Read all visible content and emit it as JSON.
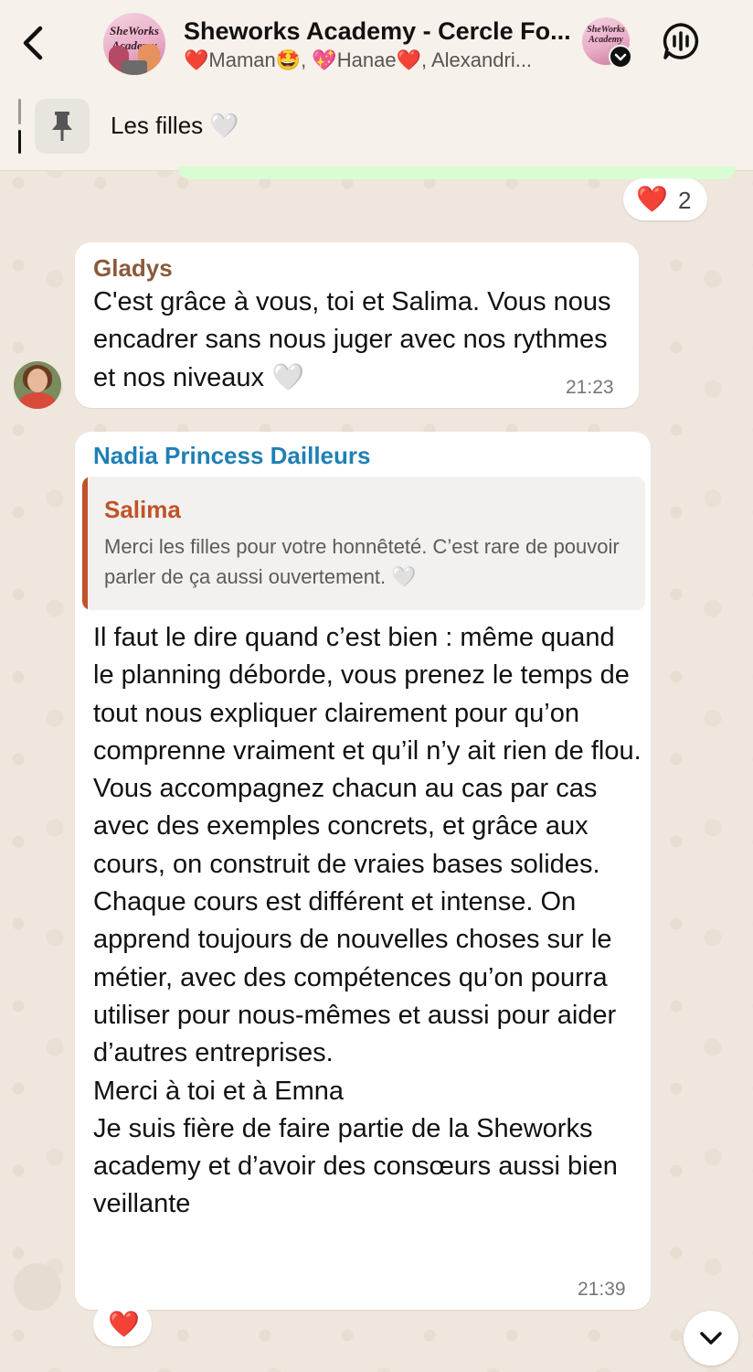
{
  "header": {
    "title": "Sheworks Academy - Cercle Fo...",
    "members": "❤️Maman🤩, 💖Hanae❤️, Alexandri...",
    "avatar_logo": "SheWorks Academy"
  },
  "pinned": {
    "text": "Les filles 🤍"
  },
  "previous_reaction": {
    "emoji": "❤️",
    "count": "2"
  },
  "messages": [
    {
      "sender": "Gladys",
      "sender_color": "#8a5a3c",
      "text": "C'est grâce à vous, toi et Salima. Vous nous encadrer sans nous juger avec nos rythmes et nos niveaux 🤍",
      "time": "21:23"
    },
    {
      "sender": "Nadia Princess Dailleurs",
      "sender_color": "#1f7fb5",
      "quote": {
        "sender": "Salima",
        "sender_color": "#c0532a",
        "text": "Merci les filles pour votre honnêteté. C’est rare de pouvoir parler de ça aussi ouvertement. 🤍"
      },
      "text": "Il faut le dire quand c’est bien : même quand le planning déborde, vous prenez le temps de tout nous expliquer clairement pour qu’on comprenne vraiment et qu’il n’y ait rien de flou.\nVous accompagnez chacun au cas par cas avec des exemples concrets, et grâce aux cours, on construit de vraies bases solides.\nChaque cours est différent et intense. On apprend toujours de nouvelles choses sur le métier, avec des compétences qu’on pourra utiliser pour nous-mêmes et aussi pour aider d’autres entreprises.\nMerci à toi et à Emna\nJe suis fière de faire partie de la Sheworks academy et d’avoir des consœurs aussi bien veillante",
      "time": "21:39",
      "reaction": "❤️"
    }
  ],
  "colors": {
    "accent_green": "#d9fdd3",
    "heart": "#e0242c",
    "background": "#efe7dd"
  },
  "icons": [
    "chevron-left-icon",
    "audio-call-icon",
    "pin-icon",
    "chevron-down-icon",
    "verified-icon"
  ]
}
